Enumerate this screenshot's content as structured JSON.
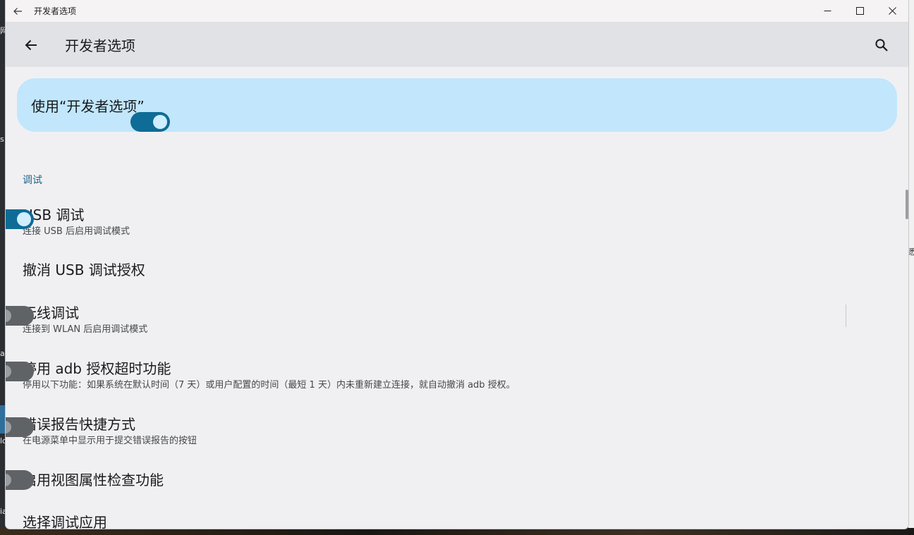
{
  "titlebar": {
    "title": "开发者选项"
  },
  "appbar": {
    "title": "开发者选项"
  },
  "master": {
    "label": "使用“开发者选项”",
    "enabled": true
  },
  "section": {
    "header": "调试"
  },
  "prefs": [
    {
      "title": "USB 调试",
      "summary": "连接 USB 后启用调试模式",
      "switch": true
    },
    {
      "title": "撤消 USB 调试授权",
      "summary": ""
    },
    {
      "title": "无线调试",
      "summary": "连接到 WLAN 后启用调试模式",
      "switch": false
    },
    {
      "title": "停用 adb 授权超时功能",
      "summary": "停用以下功能：如果系统在默认时间（7 天）或用户配置的时间（最短 1 天）内未重新建立连接，就自动撤消 adb 授权。",
      "switch": false
    },
    {
      "title": "错误报告快捷方式",
      "summary": "在电源菜单中显示用于提交错误报告的按钮",
      "switch": false
    },
    {
      "title": "启用视图属性检查功能",
      "summary": "",
      "switch": false
    },
    {
      "title": "选择调试应用",
      "summary": ""
    }
  ],
  "desktop_fragments": [
    "网",
    "s",
    "悉",
    "a",
    "lo",
    "ia"
  ],
  "colors": {
    "accent": "#0f6c96",
    "master_bg": "#c2e6fb",
    "section": "#1d6789"
  },
  "icons": [
    "back-arrow-icon",
    "minimize-icon",
    "maximize-icon",
    "close-icon",
    "search-icon"
  ]
}
